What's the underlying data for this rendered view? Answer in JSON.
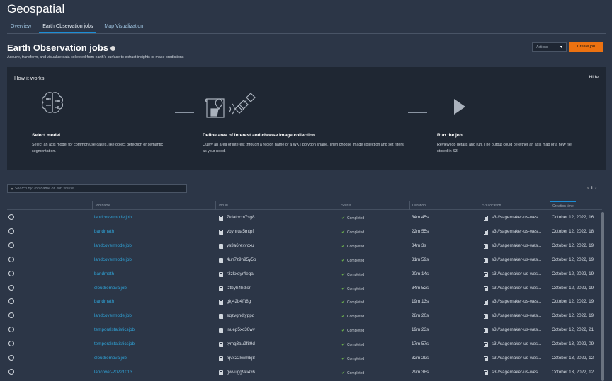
{
  "app_title": "Geospatial",
  "tabs": [
    {
      "label": "Overview"
    },
    {
      "label": "Earth Observation jobs"
    },
    {
      "label": "Map Visualization"
    }
  ],
  "page": {
    "title": "Earth Observation jobs",
    "subtitle": "Acquire, transform, and visualize data collected from earth's surface to extract insights or make predictions",
    "actions_label": "Actions",
    "create_label": "Create job"
  },
  "how": {
    "title": "How it works",
    "hide": "Hide",
    "steps": [
      {
        "title": "Select model",
        "desc": "Select an axis model for common use cases, like object detection or semantic segmentation."
      },
      {
        "title": "Define area of interest and choose image collection",
        "desc": "Query an area of interest through a region name or a WKT polygon shape. Then choose image collection and set filters as your need."
      },
      {
        "title": "Run the job",
        "desc": "Review job details and run. The output could be either an axis map or a new file stored in S3."
      }
    ]
  },
  "search": {
    "placeholder": "Search by Job name or Job status"
  },
  "pager": {
    "page": "1"
  },
  "columns": [
    "Job name",
    "Job Id",
    "Status",
    "Duration",
    "S3 Location",
    "Creation time"
  ],
  "rows": [
    {
      "name": "landcovermodeljob",
      "id": "7tdatbcm7sg8",
      "status": "Completed",
      "duration": "34m 45s",
      "s3": "s3://sagemaker-us-wes...",
      "created": "October 12, 2022, 16"
    },
    {
      "name": "bandmath",
      "id": "vbynrua5mtpf",
      "status": "Completed",
      "duration": "22m 55s",
      "s3": "s3://sagemaker-us-wes...",
      "created": "October 12, 2022, 18"
    },
    {
      "name": "landcovermodeljob",
      "id": "ys3a6rexvcxu",
      "status": "Completed",
      "duration": "34m 3s",
      "s3": "s3://sagemaker-us-wes...",
      "created": "October 12, 2022, 19"
    },
    {
      "name": "landcovermodeljob",
      "id": "4uh7z9n95y5p",
      "status": "Completed",
      "duration": "31m 59s",
      "s3": "s3://sagemaker-us-wes...",
      "created": "October 12, 2022, 19"
    },
    {
      "name": "bandmath",
      "id": "r3zkxqyr4eqa",
      "status": "Completed",
      "duration": "20m 14s",
      "s3": "s3://sagemaker-us-wes...",
      "created": "October 12, 2022, 19"
    },
    {
      "name": "cloudremovaljob",
      "id": "iztbyh4hdisr",
      "status": "Completed",
      "duration": "34m 52s",
      "s3": "s3://sagemaker-us-wes...",
      "created": "October 12, 2022, 19"
    },
    {
      "name": "bandmath",
      "id": "gkj42b4fft8g",
      "status": "Completed",
      "duration": "19m 13s",
      "s3": "s3://sagemaker-us-wes...",
      "created": "October 12, 2022, 19"
    },
    {
      "name": "landcovermodeljob",
      "id": "eqzvgndtyppd",
      "status": "Completed",
      "duration": "28m 20s",
      "s3": "s3://sagemaker-us-wes...",
      "created": "October 12, 2022, 19"
    },
    {
      "name": "temporalstatisticsjob",
      "id": "inuep5xc36wv",
      "status": "Completed",
      "duration": "19m 23s",
      "s3": "s3://sagemaker-us-wes...",
      "created": "October 12, 2022, 21"
    },
    {
      "name": "temporalstatisticsjob",
      "id": "tymg3au9f89d",
      "status": "Completed",
      "duration": "17m 57s",
      "s3": "s3://sagemaker-us-wes...",
      "created": "October 13, 2022, 09"
    },
    {
      "name": "cloudremovaljob",
      "id": "fqvx22kwm8j8",
      "status": "Completed",
      "duration": "32m 29s",
      "s3": "s3://sagemaker-us-wes...",
      "created": "October 13, 2022, 12"
    },
    {
      "name": "lancover-20221013",
      "id": "gwvugg9ki4x6",
      "status": "Completed",
      "duration": "29m 38s",
      "s3": "s3://sagemaker-us-wes...",
      "created": "October 13, 2022, 12"
    }
  ]
}
